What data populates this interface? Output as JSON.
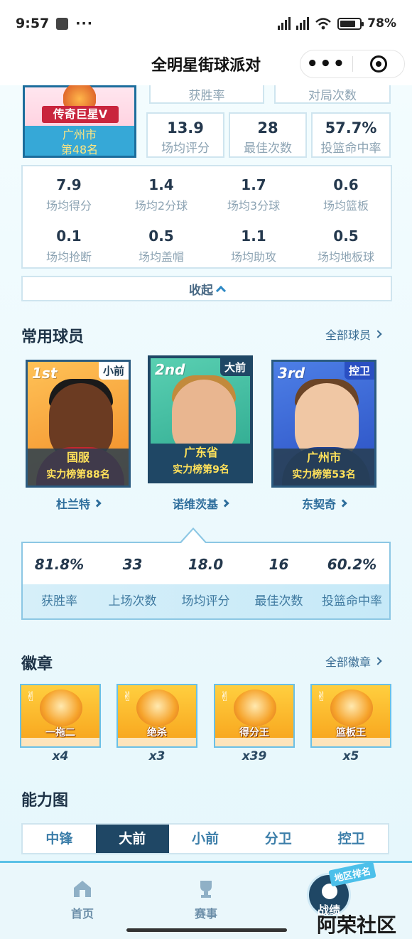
{
  "status_bar": {
    "time": "9:57",
    "dots": "···",
    "battery": "78%"
  },
  "header": {
    "title": "全明星街球派对",
    "more": "•••"
  },
  "profile": {
    "tier": "传奇巨星V",
    "city": "广州市",
    "rank": "第48名",
    "clipped_labels": [
      "获胜率",
      "对局次数"
    ],
    "stats": [
      {
        "value": "13.9",
        "label": "场均评分"
      },
      {
        "value": "28",
        "label": "最佳次数"
      },
      {
        "value": "57.7%",
        "label": "投篮命中率"
      }
    ]
  },
  "averages": [
    {
      "value": "7.9",
      "label": "场均得分"
    },
    {
      "value": "1.4",
      "label": "场均2分球"
    },
    {
      "value": "1.7",
      "label": "场均3分球"
    },
    {
      "value": "0.6",
      "label": "场均篮板"
    },
    {
      "value": "0.1",
      "label": "场均抢断"
    },
    {
      "value": "0.5",
      "label": "场均盖帽"
    },
    {
      "value": "1.1",
      "label": "场均助攻"
    },
    {
      "value": "0.5",
      "label": "场均地板球"
    }
  ],
  "collapse_label": "收起",
  "players_section": {
    "title": "常用球员",
    "link": "全部球员",
    "players": [
      {
        "rank": "1st",
        "position": "小前",
        "region": "国服",
        "standing": "实力榜第88名",
        "name": "杜兰特"
      },
      {
        "rank": "2nd",
        "position": "大前",
        "region": "广东省",
        "standing": "实力榜第9名",
        "name": "诺维茨基"
      },
      {
        "rank": "3rd",
        "position": "控卫",
        "region": "广州市",
        "standing": "实力榜第53名",
        "name": "东契奇"
      }
    ],
    "selected_stats": [
      {
        "value": "81.8%",
        "label": "获胜率"
      },
      {
        "value": "33",
        "label": "上场次数"
      },
      {
        "value": "18.0",
        "label": "场均评分"
      },
      {
        "value": "16",
        "label": "最佳次数"
      },
      {
        "value": "60.2%",
        "label": "投篮命中率"
      }
    ]
  },
  "badges_section": {
    "title": "徽章",
    "link": "全部徽章",
    "badges": [
      {
        "name": "一拖二",
        "count": "x4"
      },
      {
        "name": "绝杀",
        "count": "x3"
      },
      {
        "name": "得分王",
        "count": "x39"
      },
      {
        "name": "篮板王",
        "count": "x5"
      }
    ]
  },
  "ability_section": {
    "title": "能力图",
    "tabs": [
      "中锋",
      "大前",
      "小前",
      "分卫",
      "控卫"
    ],
    "active_tab": "大前"
  },
  "bottom_nav": {
    "items": [
      "首页",
      "赛事",
      "战绩"
    ],
    "active": "战绩",
    "region_tag": "地区排名"
  },
  "watermark": "阿荣社区",
  "colors": {
    "accent": "#1f4765",
    "link": "#3a6d94",
    "badge_gold": "#f7a21b",
    "tier_red": "#c9253d"
  }
}
